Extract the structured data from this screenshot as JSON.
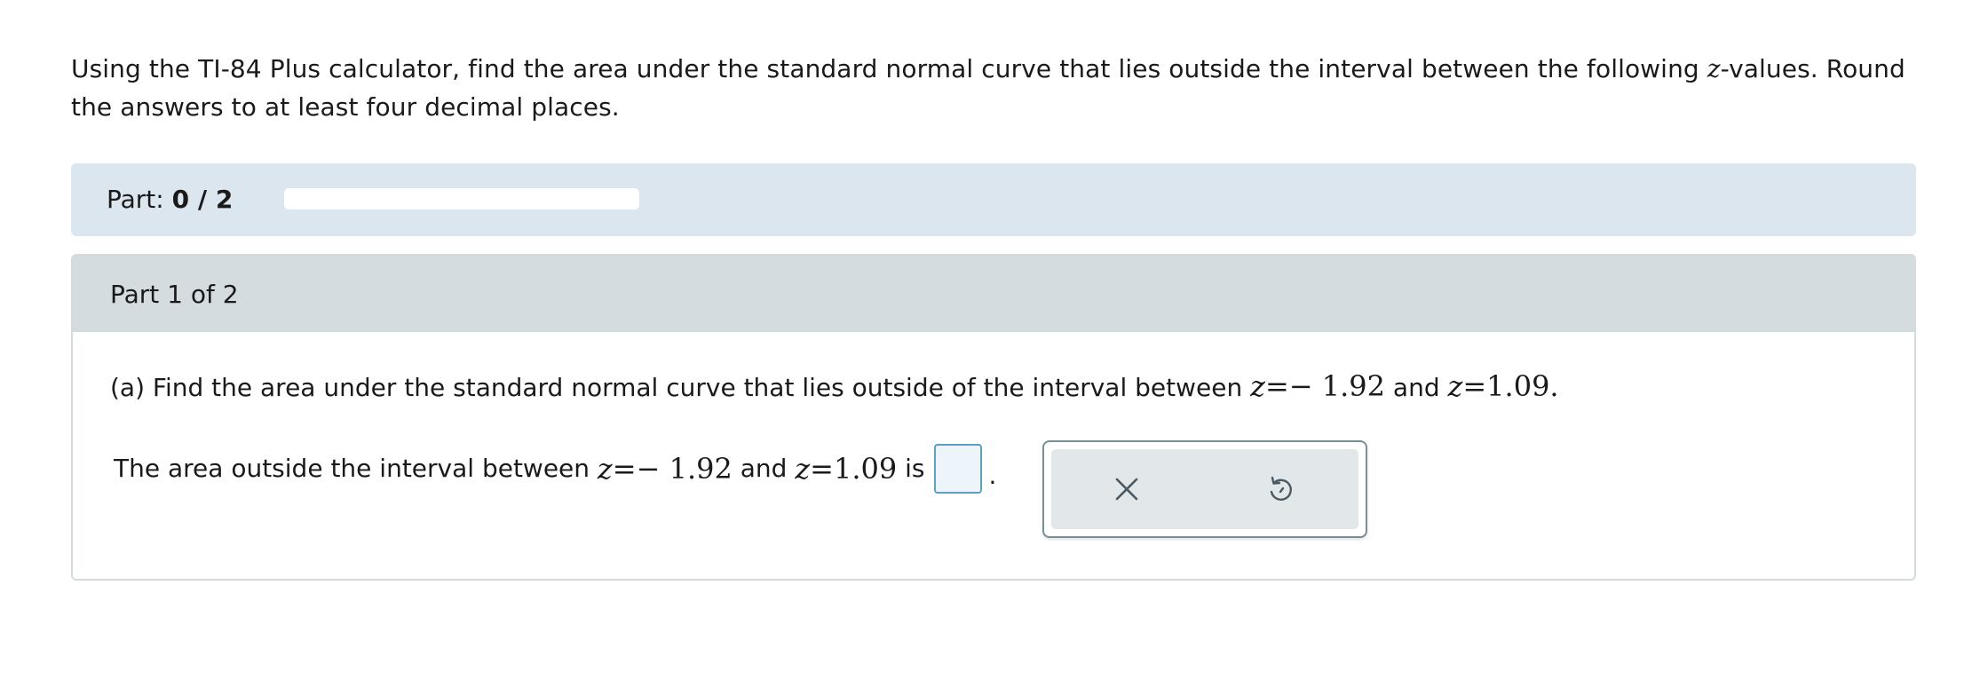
{
  "intro": {
    "before_var": "Using the TI-84 Plus calculator, find the area under the standard normal curve that lies outside the interval between the following ",
    "var": "z",
    "after_var": "-values. Round the answers to at least four decimal places."
  },
  "progress": {
    "label": "Part: ",
    "count": "0 / 2",
    "fraction": 0
  },
  "part": {
    "header": "Part 1 of 2",
    "question": {
      "prefix": "(a) Find the area under the standard normal curve that lies outside of the interval between ",
      "z1_var": "z",
      "z1_eq": "=",
      "z1_val": "− 1.92",
      "and": " and ",
      "z2_var": "z",
      "z2_eq": "=",
      "z2_val": "1.09",
      "suffix": "."
    },
    "answer": {
      "prefix": "The area outside the interval between ",
      "z1_var": "z",
      "z1_eq": "=",
      "z1_val": "− 1.92",
      "and": " and ",
      "z2_var": "z",
      "z2_eq": "=",
      "z2_val": "1.09",
      "is": " is",
      "value": "",
      "period": "."
    }
  },
  "tools": {
    "clear_icon": "close-icon",
    "undo_icon": "undo-icon"
  },
  "colors": {
    "progress_bg": "#dce6ee",
    "header_bg": "#d5dcdf",
    "answer_border": "#5ba3bf",
    "icon_color": "#4a5a62"
  }
}
